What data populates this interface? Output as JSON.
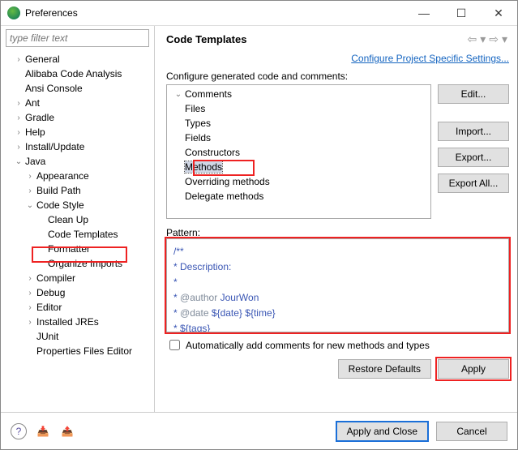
{
  "window": {
    "title": "Preferences"
  },
  "filter": {
    "placeholder": "type filter text"
  },
  "left_tree": {
    "general": "General",
    "alibaba": "Alibaba Code Analysis",
    "ansi": "Ansi Console",
    "ant": "Ant",
    "gradle": "Gradle",
    "help": "Help",
    "install": "Install/Update",
    "java": "Java",
    "appearance": "Appearance",
    "buildpath": "Build Path",
    "codestyle": "Code Style",
    "cleanup": "Clean Up",
    "codetemplates": "Code Templates",
    "formatter": "Formatter",
    "organize": "Organize Imports",
    "compiler": "Compiler",
    "debug": "Debug",
    "editor": "Editor",
    "installedjres": "Installed JREs",
    "junit": "JUnit",
    "propfiles": "Properties Files Editor"
  },
  "right": {
    "heading": "Code Templates",
    "configure_link": "Configure Project Specific Settings...",
    "tree_label": "Configure generated code and comments:",
    "tree": {
      "comments": "Comments",
      "files": "Files",
      "types": "Types",
      "fields": "Fields",
      "constructors": "Constructors",
      "methods": "Methods",
      "overriding": "Overriding methods",
      "delegate": "Delegate methods"
    },
    "buttons": {
      "edit": "Edit...",
      "import": "Import...",
      "export": "Export...",
      "exportall": "Export All..."
    },
    "pattern_label": "Pattern:",
    "pattern": {
      "l1": "/**",
      "l2": " * Description:",
      "l3": " *",
      "l4a": " * ",
      "l4tag": "@author",
      "l4b": " JourWon",
      "l5a": " * ",
      "l5tag": "@date",
      "l5b": " ${date} ${time}",
      "l6": " * ${tags}"
    },
    "auto_label": "Automatically add comments for new methods and types",
    "restore": "Restore Defaults",
    "apply": "Apply"
  },
  "footer": {
    "apply_close": "Apply and Close",
    "cancel": "Cancel"
  }
}
